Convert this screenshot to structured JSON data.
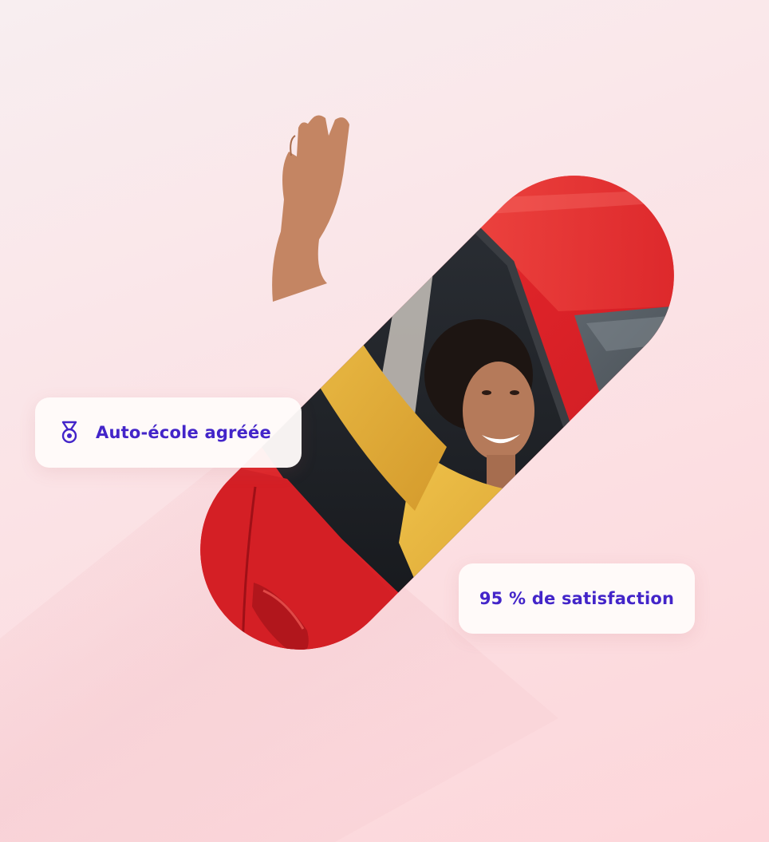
{
  "badges": {
    "approved": {
      "label": "Auto-école agréée",
      "icon": "medal-icon"
    },
    "satisfaction": {
      "label": "95 % de satisfaction"
    }
  },
  "photo": {
    "subject_icon": "person-waving-from-car-photo"
  },
  "colors": {
    "accent_text": "#4325c9",
    "car_red": "#e0262b",
    "sweater_yellow": "#e3b23a",
    "background_pink": "#fbe3e6",
    "badge_background": "#fffbfa"
  }
}
